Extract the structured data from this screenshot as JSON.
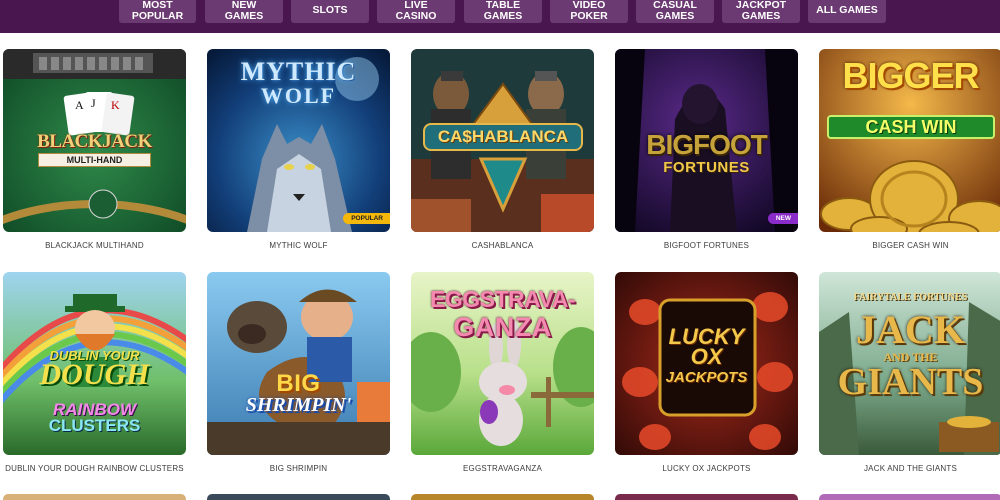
{
  "nav": [
    {
      "label": "Most Popular",
      "lines": [
        "MOST",
        "POPULAR"
      ]
    },
    {
      "label": "New Games",
      "lines": [
        "NEW",
        "GAMES"
      ]
    },
    {
      "label": "Slots",
      "lines": [
        "SLOTS"
      ]
    },
    {
      "label": "Live Casino",
      "lines": [
        "LIVE",
        "CASINO"
      ]
    },
    {
      "label": "Table Games",
      "lines": [
        "TABLE",
        "GAMES"
      ]
    },
    {
      "label": "Video Poker",
      "lines": [
        "VIDEO",
        "POKER"
      ]
    },
    {
      "label": "Casual Games",
      "lines": [
        "CASUAL",
        "GAMES"
      ]
    },
    {
      "label": "Jackpot Games",
      "lines": [
        "JACKPOT",
        "GAMES"
      ]
    },
    {
      "label": "All Games",
      "lines": [
        "ALL GAMES"
      ]
    }
  ],
  "games": [
    {
      "id": "blackjack",
      "caption": "BLACKJACK MULTIHAND",
      "logo": [
        "BLACKJACK",
        "MULTI-HAND"
      ],
      "badge": ""
    },
    {
      "id": "mythic-wolf",
      "caption": "MYTHIC WOLF",
      "logo": [
        "MYTHIC",
        "WOLF"
      ],
      "badge": "POPULAR"
    },
    {
      "id": "cashablanca",
      "caption": "CASHABLANCA",
      "logo": [
        "CA$HABLANCA"
      ],
      "badge": ""
    },
    {
      "id": "bigfoot",
      "caption": "BIGFOOT FORTUNES",
      "logo": [
        "BIGFOOT",
        "FORTUNES"
      ],
      "badge": "NEW"
    },
    {
      "id": "bigger-cash-win",
      "caption": "BIGGER CASH WIN",
      "logo": [
        "BIGGER",
        "CASH WIN"
      ],
      "badge": ""
    },
    {
      "id": "dublin",
      "caption": "DUBLIN YOUR DOUGH RAINBOW CLUSTERS",
      "logo": [
        "Dublin your",
        "dough",
        "Rainbow",
        "CLUSTERS"
      ],
      "badge": ""
    },
    {
      "id": "big-shrimpin",
      "caption": "BIG SHRIMPIN",
      "logo": [
        "BIG",
        "Shrimpin'"
      ],
      "badge": ""
    },
    {
      "id": "eggstravaganza",
      "caption": "EGGSTRAVAGANZA",
      "logo": [
        "EGGSTRAVA-",
        "GANZA"
      ],
      "badge": ""
    },
    {
      "id": "lucky-ox",
      "caption": "LUCKY OX JACKPOTS",
      "logo": [
        "LUCKY",
        "OX",
        "JACKPOTS"
      ],
      "badge": ""
    },
    {
      "id": "jack-giants",
      "caption": "JACK AND THE GIANTS",
      "logo": [
        "FAIRYTALE FORTUNES",
        "JACK",
        "AND THE",
        "GIANTS"
      ],
      "badge": ""
    }
  ],
  "colors": {
    "nav_bar": "#4a1650",
    "nav_button": "#6c3a72",
    "badge_popular": "#f5b80a",
    "badge_new": "#8a2cc9"
  }
}
